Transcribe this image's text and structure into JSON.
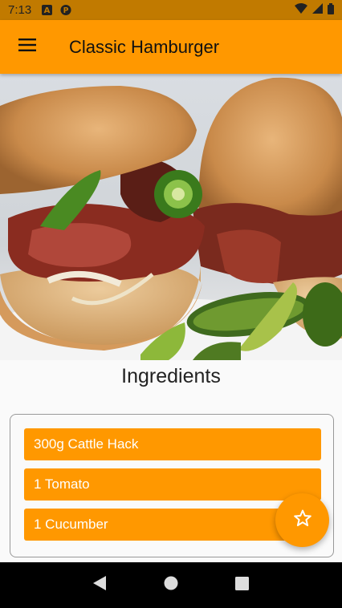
{
  "status_bar": {
    "time": "7:13",
    "icons": [
      "notification-a-icon",
      "notification-p-icon",
      "wifi-icon",
      "signal-icon",
      "battery-icon"
    ]
  },
  "app_bar": {
    "title": "Classic Hamburger",
    "menu_icon": "hamburger-menu-icon",
    "background": "#ff9800"
  },
  "hero_image": {
    "subject": "burger-photo"
  },
  "ingredients": {
    "heading": "Ingredients",
    "items": [
      "300g Cattle Hack",
      "1 Tomato",
      "1 Cucumber"
    ]
  },
  "fab": {
    "icon": "star-outline-icon"
  },
  "nav_bar": {
    "icons": [
      "back-icon",
      "home-icon",
      "recents-icon"
    ]
  },
  "colors": {
    "accent": "#ff9800",
    "status_bar": "#c17a00",
    "text_on_accent": "#ffffff"
  }
}
